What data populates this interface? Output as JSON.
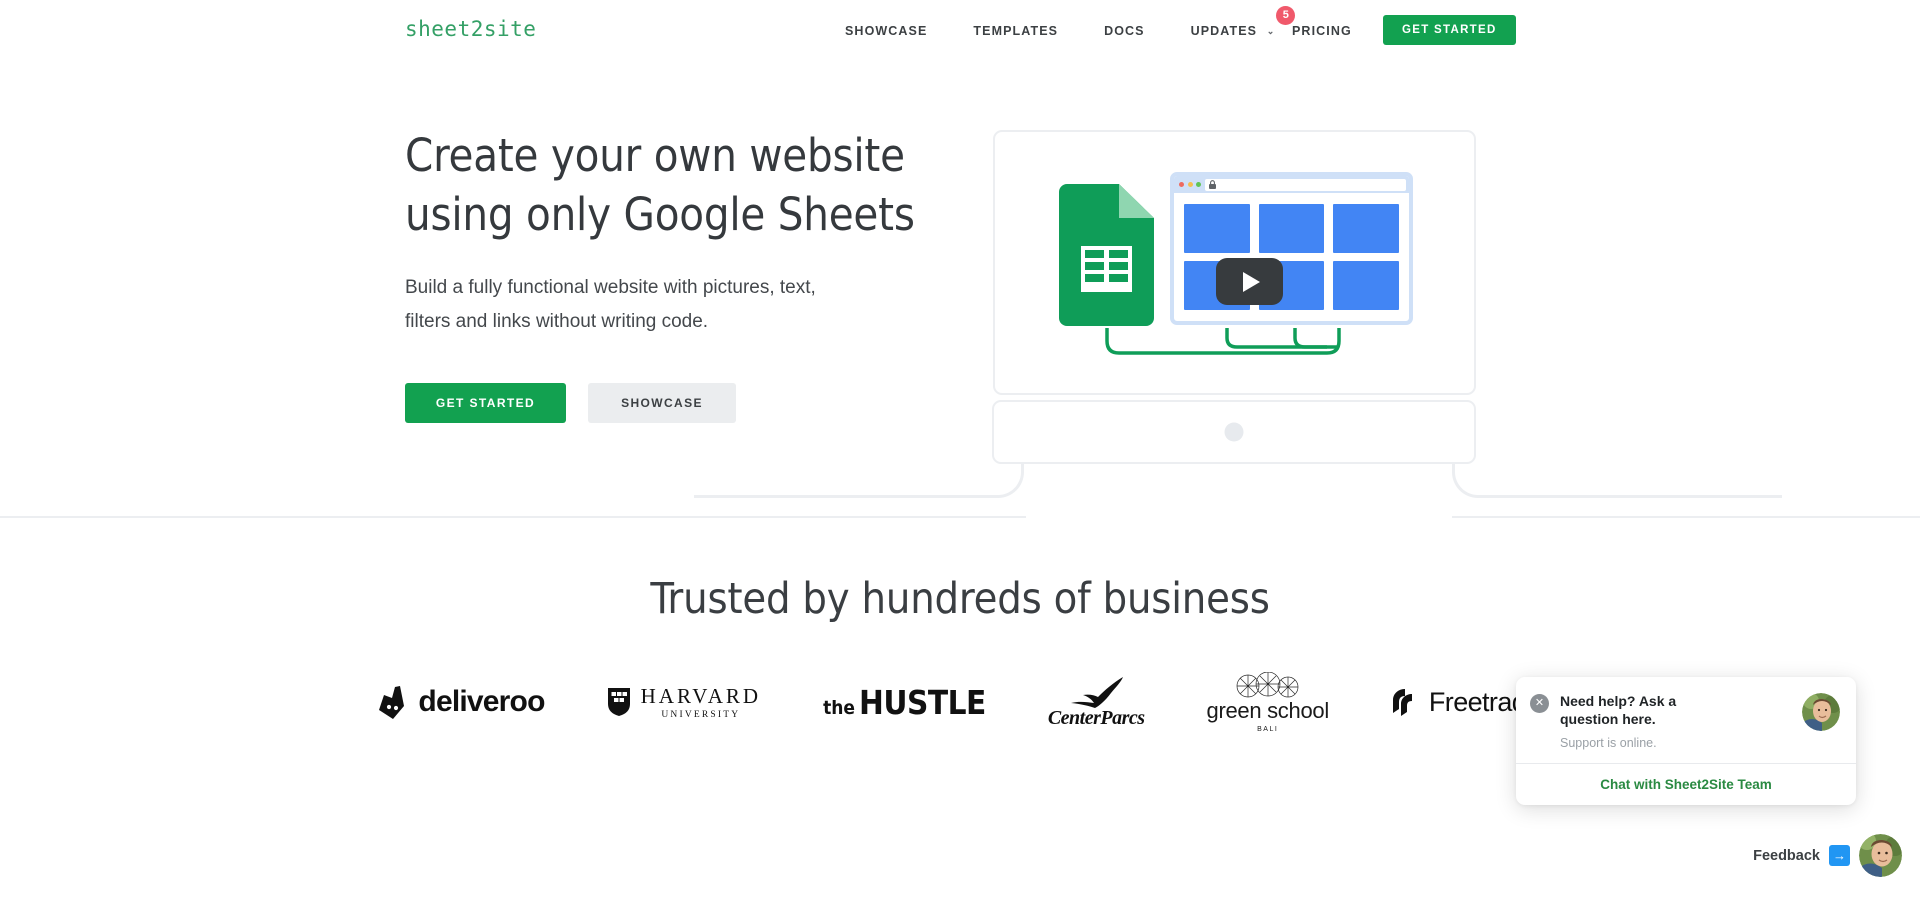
{
  "brand": {
    "name": "sheet2site",
    "color": "#34a066"
  },
  "nav": {
    "links": [
      {
        "label": "SHOWCASE",
        "has_caret": false,
        "badge": null
      },
      {
        "label": "TEMPLATES",
        "has_caret": false,
        "badge": null
      },
      {
        "label": "DOCS",
        "has_caret": false,
        "badge": null
      },
      {
        "label": "UPDATES",
        "has_caret": true,
        "badge": "5"
      }
    ],
    "pricing_label": "PRICING",
    "cta_label": "GET STARTED",
    "badge_count": "5",
    "caret_glyph": "⌄",
    "cta_color": "#12a150",
    "badge_color": "#f0596b"
  },
  "hero": {
    "title_line1": "Create your own website",
    "title_line2": "using only Google Sheets",
    "subtitle_line1": "Build a fully functional website with pictures, text,",
    "subtitle_line2": "filters and links without writing code.",
    "primary_button": "GET STARTED",
    "secondary_button": "SHOWCASE"
  },
  "illustration": {
    "browser_lock_glyph": "🔒",
    "play_label": "play",
    "tile_color": "#4285f4",
    "sheets_color": "#0f9d58",
    "wire_color": "#0f9d58"
  },
  "trusted": {
    "title": "Trusted by hundreds of business",
    "logos": [
      {
        "name": "deliveroo",
        "text": "deliveroo"
      },
      {
        "name": "harvard-university",
        "text": "HARVARD",
        "sub": "UNIVERSITY"
      },
      {
        "name": "the-hustle",
        "text_small": "the",
        "text_main": "HUSTLE"
      },
      {
        "name": "center-parcs",
        "text": "CenterParcs"
      },
      {
        "name": "green-school",
        "text": "green school",
        "sub": "BALI"
      },
      {
        "name": "freetrade",
        "text": "Freetrade"
      }
    ]
  },
  "chat": {
    "title": "Need help? Ask a question here.",
    "status": "Support is online.",
    "footer_label": "Chat with Sheet2Site Team",
    "close_glyph": "✕",
    "footer_color": "#2a8a42"
  },
  "feedback": {
    "label": "Feedback",
    "arrow_glyph": "→",
    "arrow_color": "#2196f3"
  }
}
